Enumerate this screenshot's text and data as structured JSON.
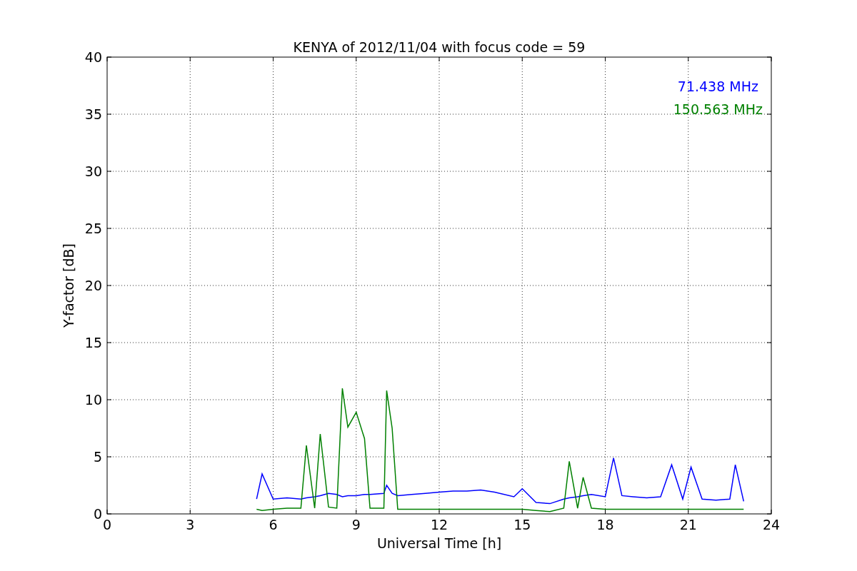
{
  "figure": {
    "chart_data": {
      "type": "line",
      "title": "KENYA of 2012/11/04 with focus code = 59",
      "xlabel": "Universal Time [h]",
      "ylabel": "Y-factor [dB]",
      "x": [
        5.4,
        5.6,
        6,
        6.5,
        7,
        7.2,
        7.5,
        7.7,
        8,
        8.3,
        8.5,
        8.7,
        9,
        9.3,
        9.5,
        10,
        10.1,
        10.3,
        10.5,
        11,
        11.5,
        12,
        12.5,
        13,
        13.5,
        14,
        14.7,
        15,
        15.5,
        16,
        16.5,
        16.7,
        17,
        17.2,
        17.5,
        18,
        18.3,
        18.6,
        19,
        19.5,
        20,
        20.4,
        20.8,
        21.1,
        21.5,
        22,
        22.5,
        22.7,
        23
      ],
      "series": [
        {
          "name": "71.438 MHz",
          "color": "#0000ff",
          "values": [
            1.3,
            3.5,
            1.3,
            1.4,
            1.3,
            1.4,
            1.5,
            1.6,
            1.8,
            1.7,
            1.5,
            1.6,
            1.6,
            1.7,
            1.7,
            1.8,
            2.5,
            1.8,
            1.6,
            1.7,
            1.8,
            1.9,
            2.0,
            2.0,
            2.1,
            1.9,
            1.5,
            2.2,
            1.0,
            0.9,
            1.3,
            1.4,
            1.5,
            1.6,
            1.7,
            1.5,
            4.9,
            1.6,
            1.5,
            1.4,
            1.5,
            4.3,
            1.3,
            4.1,
            1.3,
            1.2,
            1.3,
            4.3,
            1.1
          ]
        },
        {
          "name": "150.563 MHz",
          "color": "#008000",
          "values": [
            0.4,
            0.3,
            0.4,
            0.5,
            0.5,
            6.0,
            0.5,
            7.0,
            0.6,
            0.5,
            11.0,
            7.6,
            8.9,
            6.6,
            0.5,
            0.5,
            10.8,
            7.5,
            0.4,
            0.4,
            0.4,
            0.4,
            0.4,
            0.4,
            0.4,
            0.4,
            0.4,
            0.4,
            0.3,
            0.2,
            0.5,
            4.6,
            0.5,
            3.2,
            0.5,
            0.4,
            0.4,
            0.4,
            0.4,
            0.4,
            0.4,
            0.4,
            0.4,
            0.4,
            0.4,
            0.4,
            0.4,
            0.4,
            0.4
          ]
        }
      ],
      "grid": true,
      "xlim": [
        0,
        24
      ],
      "ylim": [
        0,
        40
      ],
      "xticks": [
        0,
        3,
        6,
        9,
        12,
        15,
        18,
        21,
        24
      ],
      "yticks": [
        0,
        5,
        10,
        15,
        20,
        25,
        30,
        35,
        40
      ]
    }
  }
}
